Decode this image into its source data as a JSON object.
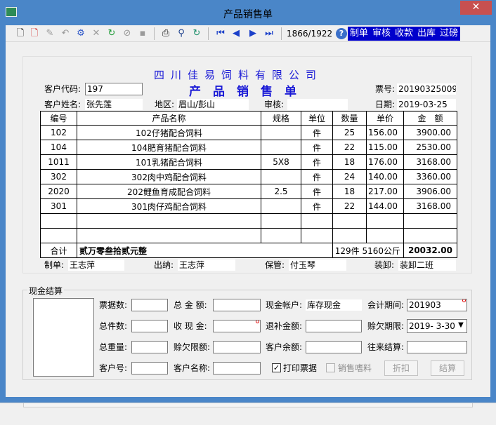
{
  "window": {
    "title": "产品销售单",
    "close_glyph": "✕"
  },
  "toolbar": {
    "icons": [
      "new-doc-icon",
      "new-red-doc-icon",
      "edit-icon",
      "undo-icon",
      "save-gear-icon",
      "delete-icon",
      "approve-icon",
      "cancel-icon",
      "save-icon",
      "print-icon",
      "find-icon",
      "refresh-icon",
      "first-icon",
      "prev-icon",
      "next-icon",
      "last-icon"
    ],
    "counter": "1866/1922",
    "help_glyph": "?",
    "menu": [
      "制单",
      "审核",
      "收款",
      "出库",
      "过磅"
    ]
  },
  "doc": {
    "company": "四川佳易饲料有限公司",
    "title": "产品销售单",
    "customer_code_label": "客户代码:",
    "customer_code": "197",
    "ticket_no_label": "票号:",
    "ticket_no": "20190325009",
    "customer_name_label": "客户姓名:",
    "customer_name": "张先莲",
    "region_label": "地区:",
    "region": "眉山/彭山",
    "review_label": "审核:",
    "review": "",
    "date_label": "日期:",
    "date": "2019-03-25"
  },
  "table": {
    "headers": [
      "编号",
      "产品名称",
      "规格",
      "单位",
      "数量",
      "单价",
      "金　额"
    ],
    "rows": [
      [
        "102",
        "102仔猪配合饲料",
        "",
        "件",
        "25",
        "156.00",
        "3900.00"
      ],
      [
        "104",
        "104肥育猪配合饲料",
        "",
        "件",
        "22",
        "115.00",
        "2530.00"
      ],
      [
        "1011",
        "101乳猪配合饲料",
        "5X8",
        "件",
        "18",
        "176.00",
        "3168.00"
      ],
      [
        "302",
        "302肉中鸡配合饲料",
        "",
        "件",
        "24",
        "140.00",
        "3360.00"
      ],
      [
        "2020",
        "202鲤鱼育成配合饲料",
        "2.5",
        "件",
        "18",
        "217.00",
        "3906.00"
      ],
      [
        "301",
        "301肉仔鸡配合饲料",
        "",
        "件",
        "22",
        "144.00",
        "3168.00"
      ],
      [
        "",
        "",
        "",
        "",
        "",
        "",
        ""
      ],
      [
        "",
        "",
        "",
        "",
        "",
        "",
        ""
      ]
    ],
    "total_label": "合计",
    "total_in_words": "贰万零叁拾贰元整",
    "total_qty": "129件 5160公斤",
    "total_amount": "20032.00"
  },
  "signatures": {
    "maker_label": "制单:",
    "maker": "王志萍",
    "cashier_label": "出纳:",
    "cashier": "王志萍",
    "keeper_label": "保管:",
    "keeper": "付玉琴",
    "loader_label": "装卸:",
    "loader": "装卸二班"
  },
  "settlement": {
    "group_title": "现金结算",
    "tickets_label": "票据数:",
    "tickets": "",
    "total_amount_label": "总 金 额:",
    "total_amount": "",
    "cash_account_label": "现金帐户:",
    "cash_account": "库存现金",
    "period_label": "会计期间:",
    "period": "201903",
    "total_pieces_label": "总件数:",
    "total_pieces": "",
    "received_label": "收 现 金:",
    "received": "",
    "refund_label": "退补金额:",
    "refund": "",
    "credit_due_label": "赊欠期限:",
    "credit_due": "2019- 3-30",
    "total_weight_label": "总重量:",
    "total_weight": "",
    "credit_limit_label": "赊欠限额:",
    "credit_limit": "",
    "balance_label": "客户余额:",
    "balance": "",
    "current_label": "往来结算:",
    "current": "",
    "customer_no_label": "客户号:",
    "customer_no": "",
    "customer_name_label": "客户名称:",
    "customer_name": "",
    "print_label": "打印票据",
    "print_checked": true,
    "print_mark": "✓",
    "sell_feed_label": "销售嗜料",
    "sell_feed_checked": false,
    "discount_btn": "折扣",
    "settle_btn": "结算"
  }
}
